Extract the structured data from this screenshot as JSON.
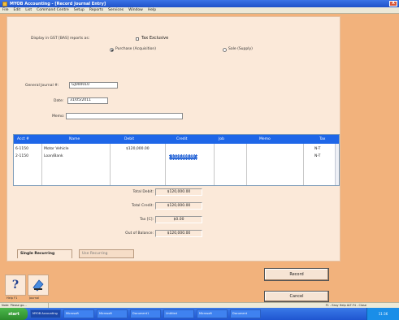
{
  "window": {
    "title": "MYOB Accounting - [Record Journal Entry]",
    "close_label": "X"
  },
  "menu": [
    "File",
    "Edit",
    "List",
    "Command Centre",
    "Setup",
    "Reports",
    "Services",
    "Window",
    "Help"
  ],
  "display_option": {
    "label": "Display in GST [BAS] reports as:",
    "tax_exclusive": "Tax Exclusive",
    "purchase_label": "Purchase (Acquisition)",
    "sale_label": "Sale (Supply)"
  },
  "form": {
    "journal_label": "General Journal #:",
    "journal_value": "GJ000010",
    "date_label": "Date:",
    "date_value": "31/05/2011",
    "memo_label": "Memo:",
    "memo_value": ""
  },
  "grid": {
    "headers": [
      "Acct #",
      "Name",
      "Debit",
      "Credit",
      "Job",
      "Memo",
      "Tax"
    ],
    "rows": [
      {
        "acct": "6-1150",
        "name": "Motor Vehicle",
        "debit": "$120,000.00",
        "credit": "",
        "job": "",
        "memo": "",
        "tax": "N-T"
      },
      {
        "acct": "2-1150",
        "name": "Loan/Bank",
        "debit": "",
        "credit": "$120,000.00",
        "job": "",
        "memo": "",
        "tax": "N-T"
      }
    ]
  },
  "totals": {
    "debit_label": "Total Debit:",
    "debit_value": "$120,000.00",
    "credit_label": "Total Credit:",
    "credit_value": "$120,000.00",
    "tax_label": "Tax [C]:",
    "tax_value": "$0.00",
    "oob_label": "Out of Balance:",
    "oob_value": "$120,000.00"
  },
  "tabs": {
    "single": "Single Recurring",
    "use": "Use Recurring"
  },
  "icons": {
    "help_caption": "Help F1",
    "journal_caption": "Journal"
  },
  "buttons": {
    "record": "Record",
    "cancel": "Cancel"
  },
  "status": {
    "left": "Note: Please go...",
    "right": "F1 - Easy Help  ALT-F4 - Close"
  },
  "taskbar": {
    "start": "start",
    "tasks": [
      "MYOB Accounting",
      "Microsoft",
      "Microsoft",
      "Document1",
      "Untitled",
      "Microsoft",
      "Document"
    ],
    "clock": "11:36"
  }
}
